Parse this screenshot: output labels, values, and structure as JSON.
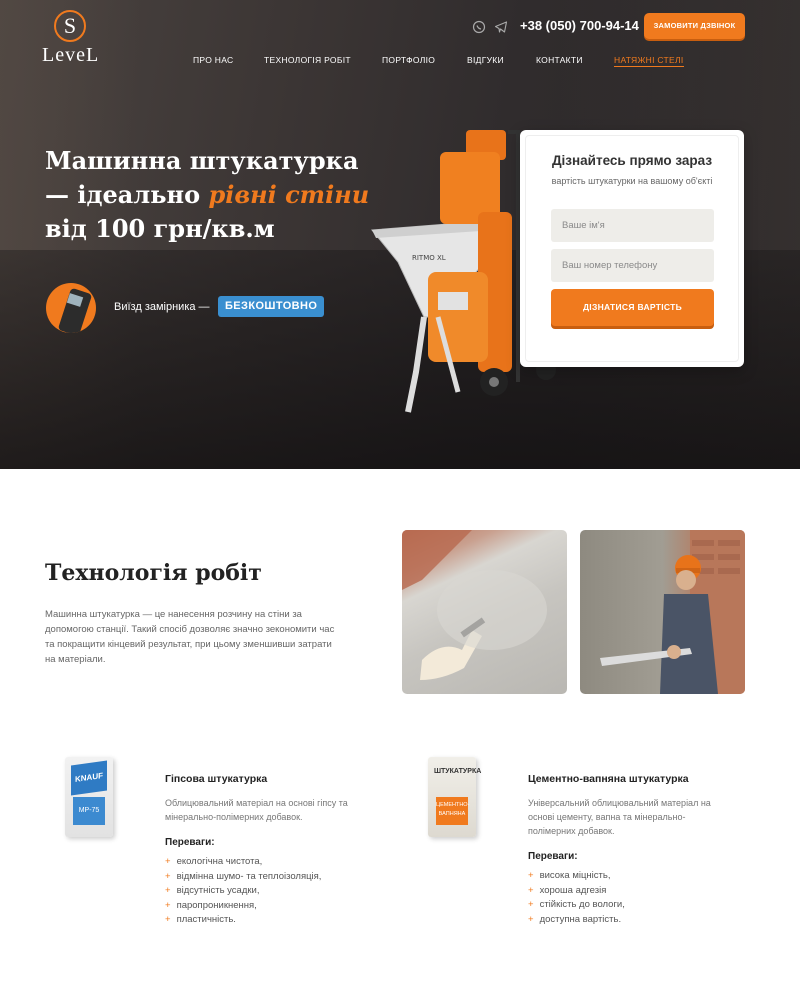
{
  "header": {
    "logo_letter": "S",
    "logo_word": "LeveL",
    "phone": "+38 (050) 700-94-14",
    "call_button": "ЗАМОВИТИ ДЗВІНОК",
    "nav": [
      "ПРО НАС",
      "ТЕХНОЛОГІЯ РОБІТ",
      "ПОРТФОЛІО",
      "ВІДГУКИ",
      "КОНТАКТИ",
      "НАТЯЖНІ СТЕЛІ"
    ]
  },
  "hero": {
    "title_line1": "Машинна штукатурка",
    "title_dash": "— ідеально ",
    "title_highlight": "рівні стіни",
    "title_line3": "від 100 грн/кв.м",
    "measure_text": "Виїзд замірника —",
    "measure_badge": "БЕЗКОШТОВНО",
    "machine_label": "RITMO XL"
  },
  "form": {
    "title": "Дізнайтесь прямо зараз",
    "subtitle": "вартість штукатурки на вашому об'єкті",
    "name_placeholder": "Ваше ім'я",
    "phone_placeholder": "Ваш номер телефону",
    "submit": "ДІЗНАТИСЯ ВАРТІСТЬ"
  },
  "tech": {
    "title": "Технологія робіт",
    "description": "Машинна штукатурка — це нанесення розчину на стіни за допомогою станції. Такий спосіб дозволяє значно зекономити час та покращити кінцевий результат, при цьому зменшивши затрати на матеріали."
  },
  "products": [
    {
      "brand": "KNAUF",
      "bag_label": "MP-75",
      "title": "Гіпсова штукатурка",
      "description": "Облицювальний матеріал на основі гіпсу та мінерально-полімерних добавок.",
      "advantages_label": "Переваги:",
      "advantages": [
        "екологічна чистота,",
        "відмінна шумо- та теплоізоляція,",
        "відсутність усадки,",
        "паропроникнення,",
        "пластичність."
      ]
    },
    {
      "brand": "ШТУКАТУРКА",
      "bag_label": "ЦЕМЕНТНО-ВАПНЯНА",
      "title": "Цементно-вапняна штукатурка",
      "description": "Універсальний облицювальний матеріал на основі цементу, вапна та мінерально-полімерних добавок.",
      "advantages_label": "Переваги:",
      "advantages": [
        "висока міцність,",
        "хороша адгезія",
        "стійкість до вологи,",
        "доступна вартість."
      ]
    }
  ],
  "colors": {
    "accent": "#f07a1e",
    "badge": "#3a8fd0"
  }
}
